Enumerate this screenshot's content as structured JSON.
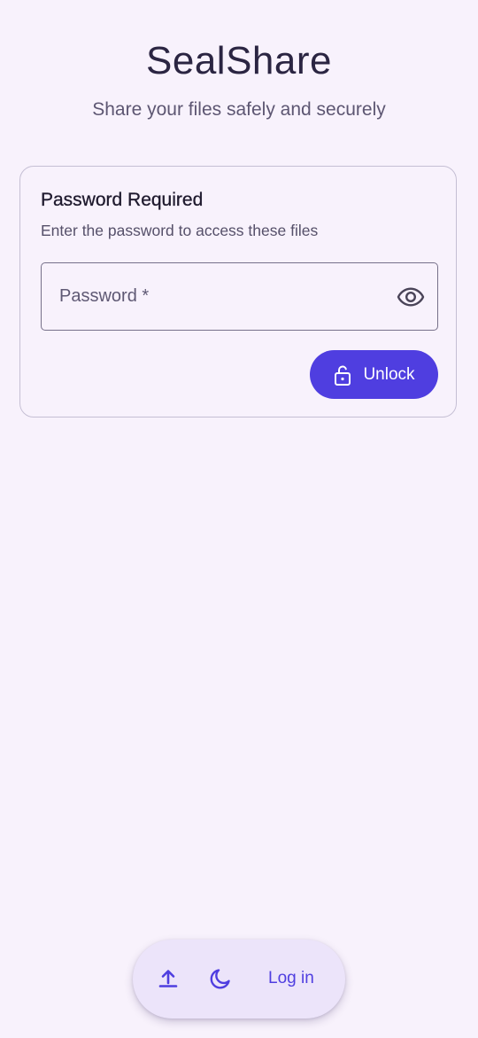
{
  "app": {
    "title": "SealShare",
    "subtitle": "Share your files safely and securely"
  },
  "card": {
    "title": "Password Required",
    "description": "Enter the password to access these files",
    "password_placeholder": "Password *",
    "password_value": "",
    "unlock_label": "Unlock"
  },
  "bottom_bar": {
    "login_label": "Log in",
    "icons": [
      "upload-icon",
      "moon-icon"
    ]
  },
  "colors": {
    "background": "#f8f2fc",
    "accent": "#4f3ee0",
    "bar_background": "#ece4fa"
  }
}
